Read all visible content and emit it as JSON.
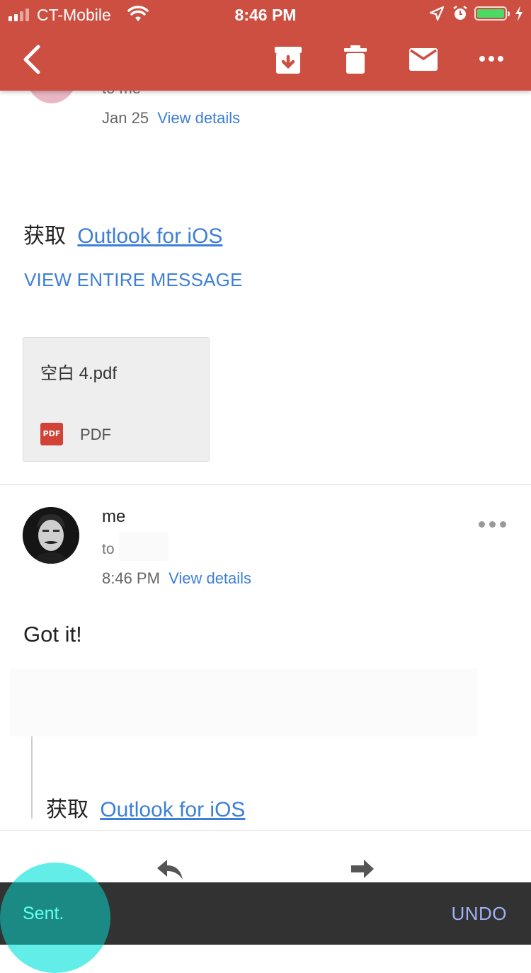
{
  "status_bar": {
    "carrier": "CT-Mobile",
    "time": "8:46 PM"
  },
  "toolbar": {
    "icons": [
      "back-arrow-icon",
      "archive-icon",
      "trash-icon",
      "mail-icon",
      "more-icon"
    ]
  },
  "prev_message": {
    "to": "to me",
    "date": "Jan 25",
    "view_details": "View details",
    "body_prefix": "获取",
    "body_link": "Outlook for iOS",
    "view_entire": "VIEW ENTIRE MESSAGE",
    "attachment": {
      "name": "空白 4.pdf",
      "type": "PDF",
      "icon_text": "PDF"
    }
  },
  "current_message": {
    "sender": "me",
    "to": "to",
    "time": "8:46 PM",
    "view_details": "View details",
    "body": "Got it!",
    "quoted_prefix": "获取",
    "quoted_link": "Outlook for iOS"
  },
  "snackbar": {
    "message": "Sent.",
    "action": "UNDO"
  },
  "colors": {
    "toolbar": "#CD4F41",
    "link": "#3D7FD7",
    "snackbar": "#323232",
    "accent": "#64FFF0"
  }
}
